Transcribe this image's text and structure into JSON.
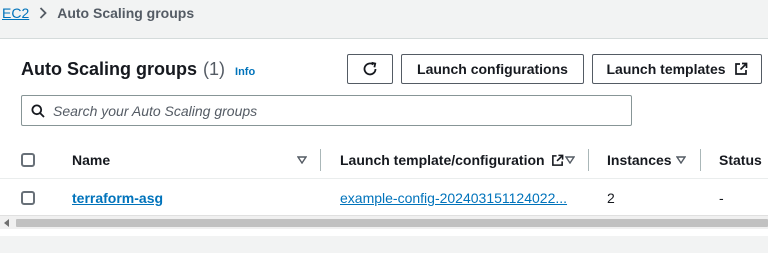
{
  "breadcrumb": {
    "root": "EC2",
    "current": "Auto Scaling groups"
  },
  "header": {
    "title": "Auto Scaling groups",
    "count": "(1)",
    "info": "Info"
  },
  "buttons": {
    "refresh_icon": "refresh-icon",
    "launch_configurations": "Launch configurations",
    "launch_templates": "Launch templates",
    "launch_templates_icon": "external-link-icon"
  },
  "search": {
    "placeholder": "Search your Auto Scaling groups",
    "value": ""
  },
  "table": {
    "columns": [
      {
        "label": "Name",
        "sortable": true
      },
      {
        "label": "Launch template/configuration",
        "external": true,
        "sortable": true
      },
      {
        "label": "Instances",
        "sortable": true
      },
      {
        "label": "Status",
        "sortable": false
      }
    ],
    "rows": [
      {
        "name": "terraform-asg",
        "launch_template": "example-config-202403151124022...",
        "instances": "2",
        "status": "-"
      }
    ]
  },
  "colors": {
    "link": "#0073bb",
    "text": "#16191f",
    "muted": "#545b64",
    "background": "#f2f3f3"
  }
}
